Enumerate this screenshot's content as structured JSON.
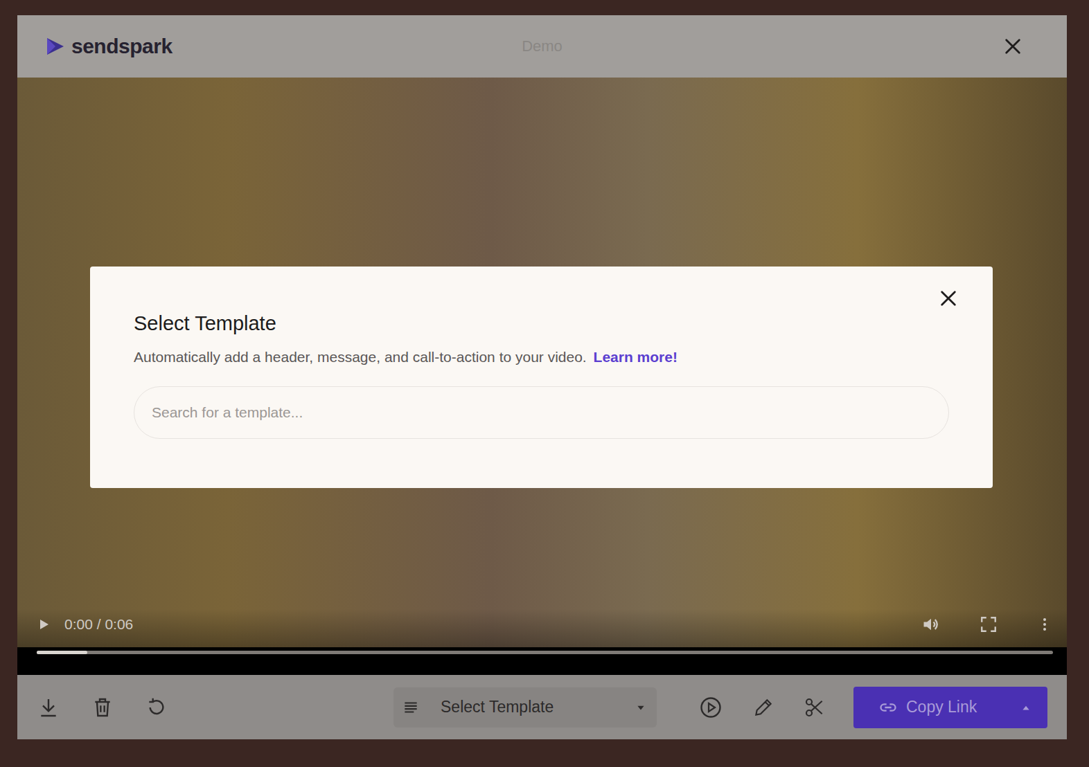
{
  "window": {
    "title": "Demo",
    "logo": "sendspark"
  },
  "video": {
    "time": "0:00 / 0:06",
    "level": 0.05
  },
  "modal": {
    "title": "Select Template",
    "description": "Automatically add a header, message, and call-to-action to your video.",
    "link": "Learn more!",
    "search": {
      "placeholder": "Search for a template..."
    }
  },
  "toolbar": {
    "template_select": "Select Template",
    "primary_button": "Copy Link"
  }
}
